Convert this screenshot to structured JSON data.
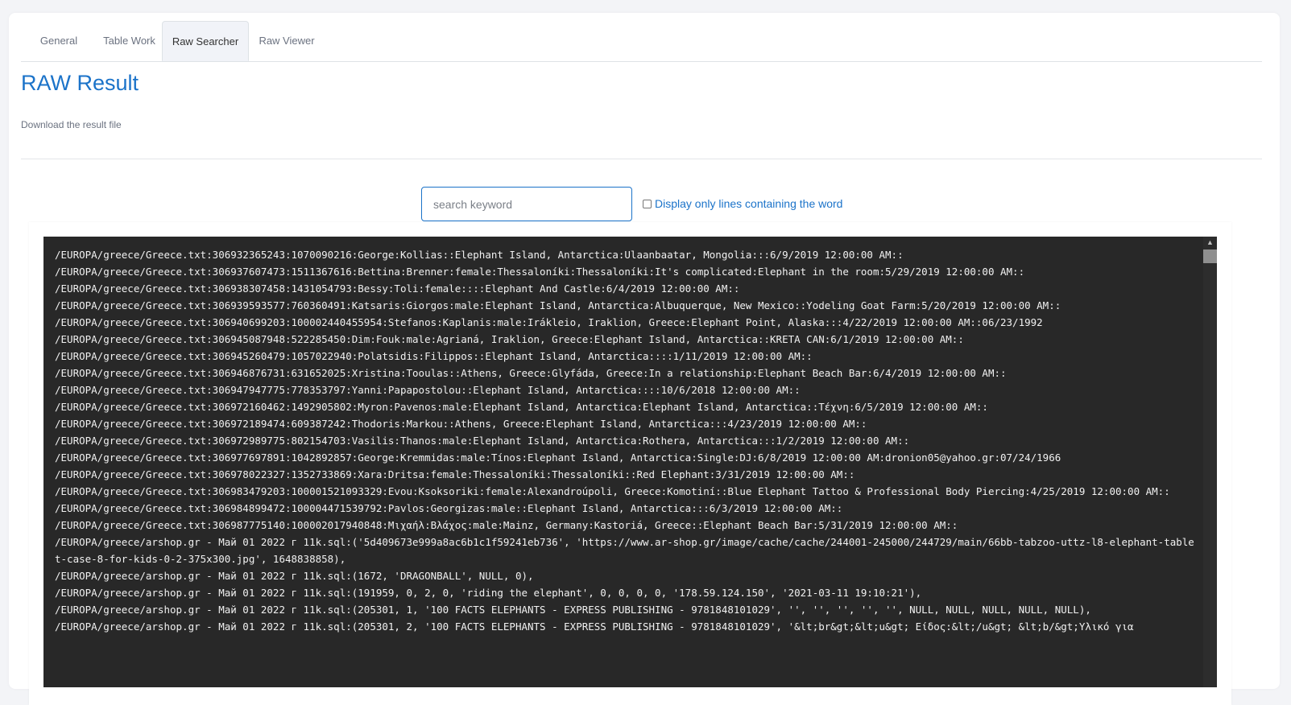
{
  "tabs": [
    {
      "label": "General",
      "active": false
    },
    {
      "label": "Table Work",
      "active": false
    },
    {
      "label": "Raw Searcher",
      "active": true
    },
    {
      "label": "Raw Viewer",
      "active": false
    }
  ],
  "title": "RAW Result",
  "download_link": "Download the result file",
  "search": {
    "placeholder": "search keyword",
    "value": ""
  },
  "filter_checkbox": {
    "label": "Display only lines containing the word",
    "checked": false
  },
  "colors": {
    "accent": "#1b73c9",
    "console_bg": "#282828"
  },
  "results": [
    "/EUROPA/greece/Greece.txt:306932365243:1070090216:George:Kollias::Elephant Island, Antarctica:Ulaanbaatar, Mongolia:::6/9/2019 12:00:00 AM::",
    "/EUROPA/greece/Greece.txt:306937607473:1511367616:Bettina:Brenner:female:Thessaloníki:Thessaloníki:It's complicated:Elephant in the room:5/29/2019 12:00:00 AM::",
    "/EUROPA/greece/Greece.txt:306938307458:1431054793:Bessy:Toli:female::::Elephant And Castle:6/4/2019 12:00:00 AM::",
    "/EUROPA/greece/Greece.txt:306939593577:760360491:Katsaris:Giorgos:male:Elephant Island, Antarctica:Albuquerque, New Mexico::Yodeling Goat Farm:5/20/2019 12:00:00 AM::",
    "/EUROPA/greece/Greece.txt:306940699203:100002440455954:Stefanos:Kaplanis:male:Irákleio, Iraklion, Greece:Elephant Point, Alaska:::4/22/2019 12:00:00 AM::06/23/1992",
    "/EUROPA/greece/Greece.txt:306945087948:522285450:Dim:Fouk:male:Agrianá, Iraklion, Greece:Elephant Island, Antarctica::KRETA CAN:6/1/2019 12:00:00 AM::",
    "/EUROPA/greece/Greece.txt:306945260479:1057022940:Polatsidis:Filippos::Elephant Island, Antarctica::::1/11/2019 12:00:00 AM::",
    "/EUROPA/greece/Greece.txt:306946876731:631652025:Xristina:Tooulas::Athens, Greece:Glyfáda, Greece:In a relationship:Elephant Beach Bar:6/4/2019 12:00:00 AM::",
    "/EUROPA/greece/Greece.txt:306947947775:778353797:Yanni:Papapostolou::Elephant Island, Antarctica::::10/6/2018 12:00:00 AM::",
    "/EUROPA/greece/Greece.txt:306972160462:1492905802:Myron:Pavenos:male:Elephant Island, Antarctica:Elephant Island, Antarctica::Τέχνη:6/5/2019 12:00:00 AM::",
    "/EUROPA/greece/Greece.txt:306972189474:609387242:Thodoris:Markou::Athens, Greece:Elephant Island, Antarctica:::4/23/2019 12:00:00 AM::",
    "/EUROPA/greece/Greece.txt:306972989775:802154703:Vasilis:Thanos:male:Elephant Island, Antarctica:Rothera, Antarctica:::1/2/2019 12:00:00 AM::",
    "/EUROPA/greece/Greece.txt:306977697891:1042892857:George:Kremmidas:male:Tínos:Elephant Island, Antarctica:Single:DJ:6/8/2019 12:00:00 AM:dronion05@yahoo.gr:07/24/1966",
    "/EUROPA/greece/Greece.txt:306978022327:1352733869:Xara:Dritsa:female:Thessaloníki:Thessaloníki::Red Elephant:3/31/2019 12:00:00 AM::",
    "/EUROPA/greece/Greece.txt:306983479203:100001521093329:Evou:Ksoksoriki:female:Alexandroúpoli, Greece:Komotiní::Blue Elephant Tattoo & Professional Body Piercing:4/25/2019 12:00:00 AM::",
    "/EUROPA/greece/Greece.txt:306984899472:100004471539792:Pavlos:Georgizas:male::Elephant Island, Antarctica:::6/3/2019 12:00:00 AM::",
    "/EUROPA/greece/Greece.txt:306987775140:100002017940848:Μιχαήλ:Βλάχος:male:Mainz, Germany:Kastoriá, Greece::Elephant Beach Bar:5/31/2019 12:00:00 AM::",
    "/EUROPA/greece/arshop.gr - Май 01 2022 г 11k.sql:('5d409673e999a8ac6b1c1f59241eb736', 'https://www.ar-shop.gr/image/cache/cache/244001-245000/244729/main/66bb-tabzoo-uttz-l8-elephant-tablet-case-8-for-kids-0-2-375x300.jpg', 1648838858),",
    "/EUROPA/greece/arshop.gr - Май 01 2022 г 11k.sql:(1672, 'DRAGONBALL', NULL, 0),",
    "/EUROPA/greece/arshop.gr - Май 01 2022 г 11k.sql:(191959, 0, 2, 0, 'riding the elephant', 0, 0, 0, 0, '178.59.124.150', '2021-03-11 19:10:21'),",
    "/EUROPA/greece/arshop.gr - Май 01 2022 г 11k.sql:(205301, 1, '100 FACTS ELEPHANTS - EXPRESS PUBLISHING - 9781848101029', '', '', '', '', '', NULL, NULL, NULL, NULL, NULL),",
    "/EUROPA/greece/arshop.gr - Май 01 2022 г 11k.sql:(205301, 2, '100 FACTS ELEPHANTS - EXPRESS PUBLISHING - 9781848101029', '&lt;br&gt;&lt;u&gt; Είδος:&lt;/u&gt; &lt;b/&gt;Υλικό για"
  ]
}
